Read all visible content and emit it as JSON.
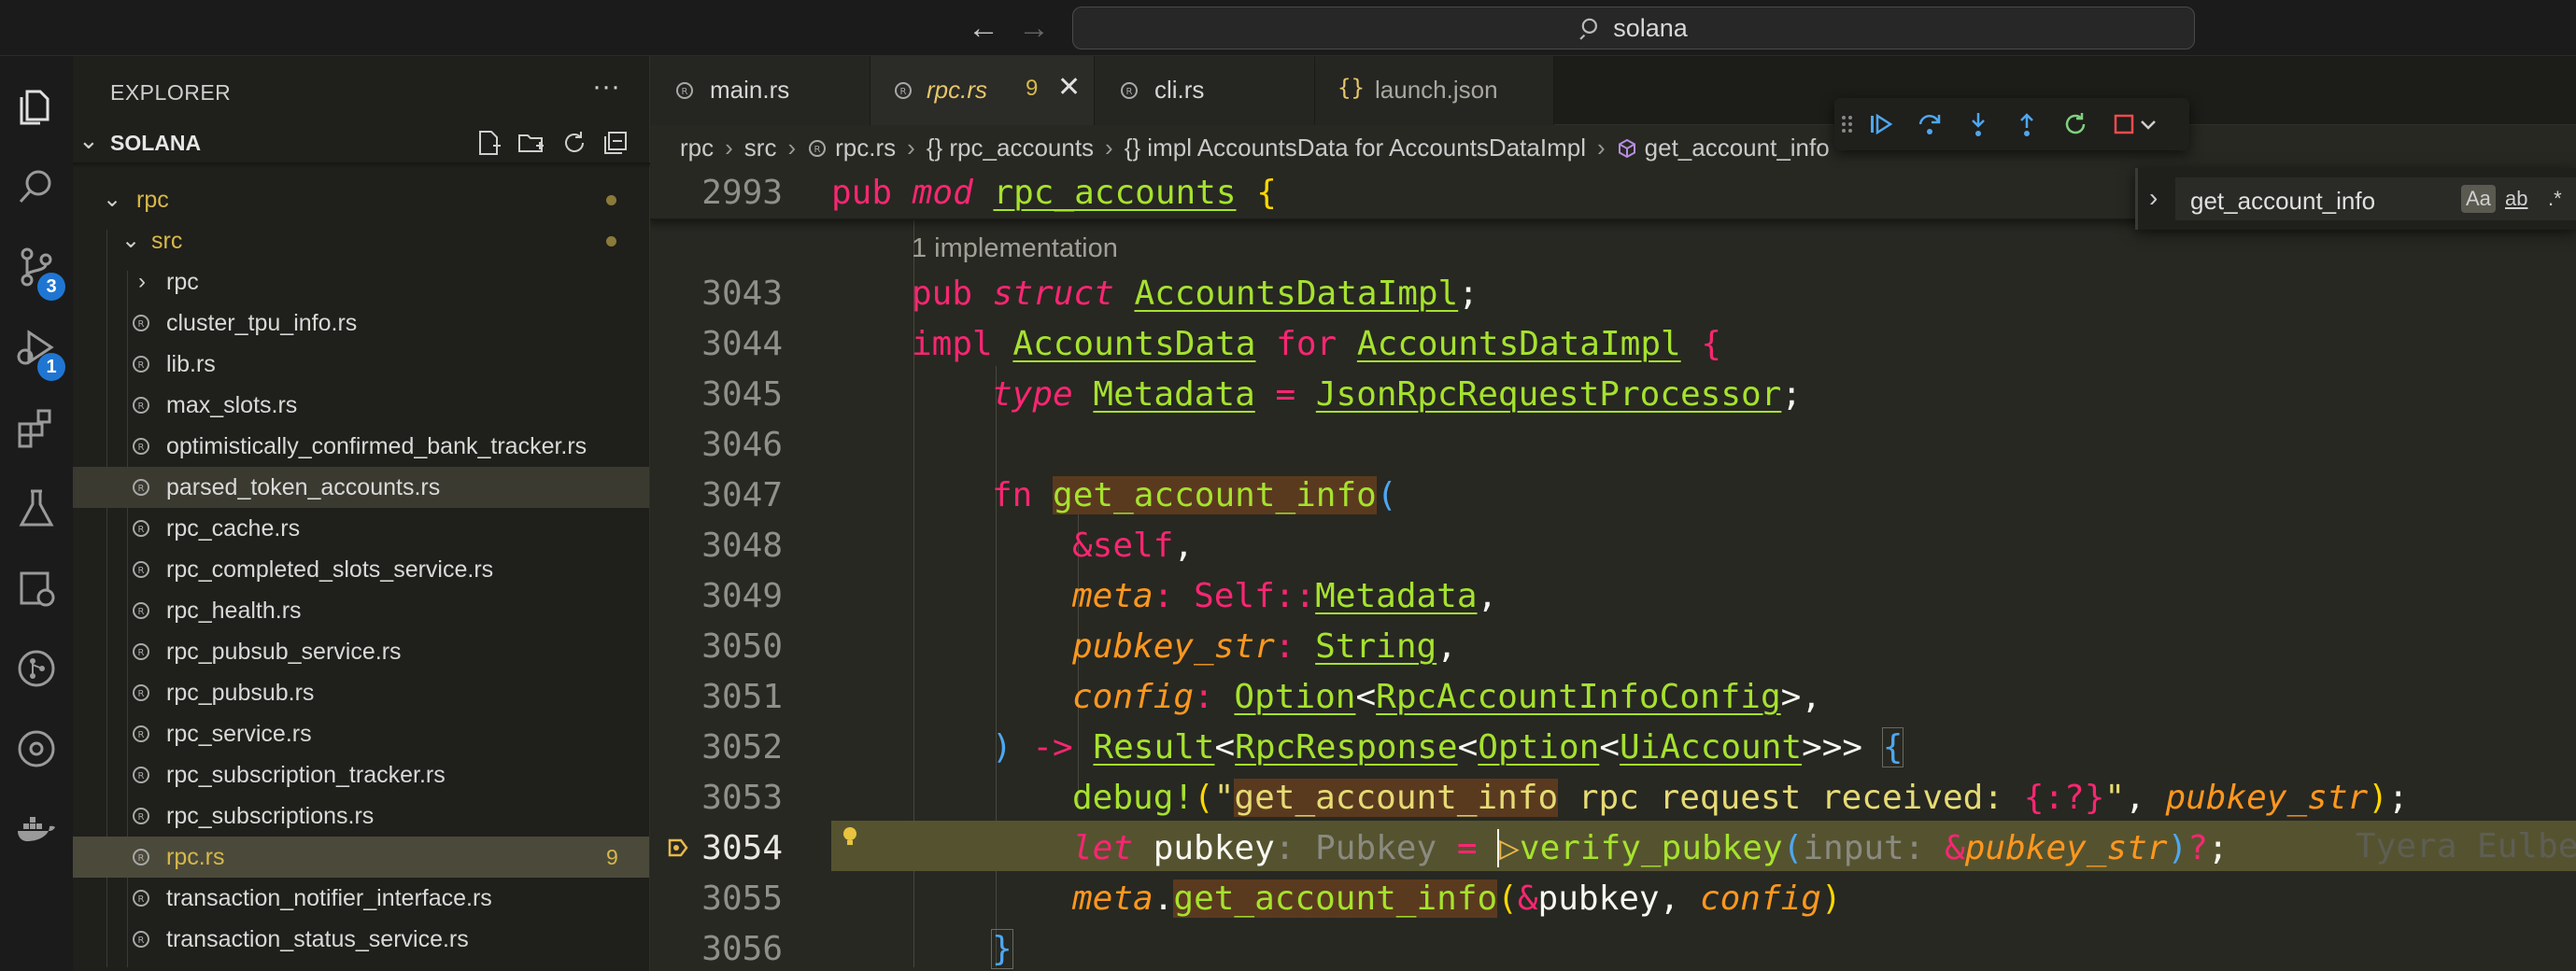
{
  "titlebar": {
    "search_text": "solana",
    "back_icon": "arrow-left-icon",
    "forward_icon": "arrow-right-icon"
  },
  "activity_bar": {
    "items": [
      {
        "name": "explorer",
        "icon": "files-icon"
      },
      {
        "name": "search",
        "icon": "search-icon"
      },
      {
        "name": "source-control",
        "icon": "source-control-icon",
        "badge": "3"
      },
      {
        "name": "run-debug",
        "icon": "debug-icon",
        "badge": "1"
      },
      {
        "name": "extensions",
        "icon": "extensions-icon"
      },
      {
        "name": "testing",
        "icon": "beaker-icon"
      },
      {
        "name": "remote",
        "icon": "remote-explorer-icon"
      },
      {
        "name": "git-graph",
        "icon": "git-graph-icon"
      },
      {
        "name": "gitlens",
        "icon": "gitlens-icon"
      },
      {
        "name": "docker",
        "icon": "docker-icon"
      }
    ]
  },
  "sidebar": {
    "title": "EXPLORER",
    "more": "···",
    "folder": "SOLANA",
    "tree": [
      {
        "label": "rpc",
        "kind": "folder-open",
        "depth": 1,
        "dot": true
      },
      {
        "label": "src",
        "kind": "folder-open",
        "depth": 2,
        "dot": true
      },
      {
        "label": "rpc",
        "kind": "folder-closed",
        "depth": 3
      },
      {
        "label": "cluster_tpu_info.rs",
        "kind": "file",
        "depth": 3
      },
      {
        "label": "lib.rs",
        "kind": "file",
        "depth": 3
      },
      {
        "label": "max_slots.rs",
        "kind": "file",
        "depth": 3
      },
      {
        "label": "optimistically_confirmed_bank_tracker.rs",
        "kind": "file",
        "depth": 3
      },
      {
        "label": "parsed_token_accounts.rs",
        "kind": "file",
        "depth": 3,
        "state": "hover"
      },
      {
        "label": "rpc_cache.rs",
        "kind": "file",
        "depth": 3
      },
      {
        "label": "rpc_completed_slots_service.rs",
        "kind": "file",
        "depth": 3
      },
      {
        "label": "rpc_health.rs",
        "kind": "file",
        "depth": 3
      },
      {
        "label": "rpc_pubsub_service.rs",
        "kind": "file",
        "depth": 3
      },
      {
        "label": "rpc_pubsub.rs",
        "kind": "file",
        "depth": 3
      },
      {
        "label": "rpc_service.rs",
        "kind": "file",
        "depth": 3
      },
      {
        "label": "rpc_subscription_tracker.rs",
        "kind": "file",
        "depth": 3
      },
      {
        "label": "rpc_subscriptions.rs",
        "kind": "file",
        "depth": 3
      },
      {
        "label": "rpc.rs",
        "kind": "file",
        "depth": 3,
        "state": "active",
        "problems": "9"
      },
      {
        "label": "transaction_notifier_interface.rs",
        "kind": "file",
        "depth": 3
      },
      {
        "label": "transaction_status_service.rs",
        "kind": "file",
        "depth": 3
      }
    ]
  },
  "tabs": [
    {
      "label": "main.rs"
    },
    {
      "label": "rpc.rs",
      "active": true,
      "problems": "9",
      "close": "✕"
    },
    {
      "label": "cli.rs"
    },
    {
      "label": "launch.json",
      "braces": "{}"
    }
  ],
  "breadcrumb": {
    "items": [
      "rpc",
      "src",
      "rpc.rs",
      "{} rpc_accounts",
      "{} impl AccountsData for AccountsDataImpl",
      "get_account_info"
    ]
  },
  "find": {
    "value": "get_account_info",
    "match_case": "Aa",
    "whole_word": "ab",
    "regex": ".*"
  },
  "editor": {
    "sticky_line": "2993",
    "codelens": "1 implementation",
    "current_line": "3054",
    "blame": "Tyera Eulberg",
    "lines": [
      "3043",
      "3044",
      "3045",
      "3046",
      "3047",
      "3048",
      "3049",
      "3050",
      "3051",
      "3052",
      "3053",
      "3054",
      "3055",
      "3056"
    ]
  },
  "colors": {
    "keyword": "#f92672",
    "type": "#a6e22e",
    "param": "#fd971f",
    "string": "#e6db74",
    "bracket": "#4ea7f0",
    "badge": "#1f76d2"
  }
}
